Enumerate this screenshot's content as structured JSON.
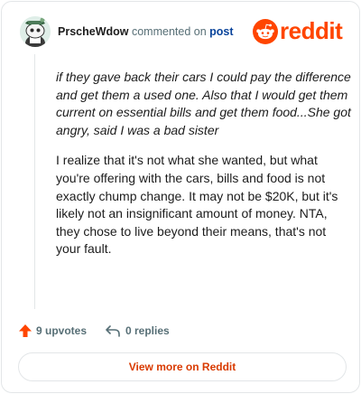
{
  "header": {
    "username": "PrscheWdow",
    "action": "commented on",
    "post_link": "post",
    "brand": "reddit"
  },
  "comment": {
    "quote": "if they gave back their cars I could pay the difference and get them a used one. Also that I would get them current on essential bills and get them food...She got angry, said I was a bad sister",
    "reply": "I realize that it's not what she wanted, but what you're offering with the cars, bills and food is not exactly chump change. It may not be $20K, but it's likely not an insignificant amount of money. NTA, they chose to live beyond their means, that's not your fault."
  },
  "footer": {
    "upvotes": "9 upvotes",
    "replies": "0 replies"
  },
  "button": {
    "label": "View more on Reddit"
  },
  "colors": {
    "brand": "#ff4500",
    "link": "#0a449b",
    "button_text": "#d93a00",
    "muted": "#576f76"
  },
  "icons": {
    "avatar": "snoo-avatar",
    "logo": "reddit-snoo-icon",
    "upvote": "upvote-arrow-icon",
    "reply": "reply-arrow-icon"
  }
}
